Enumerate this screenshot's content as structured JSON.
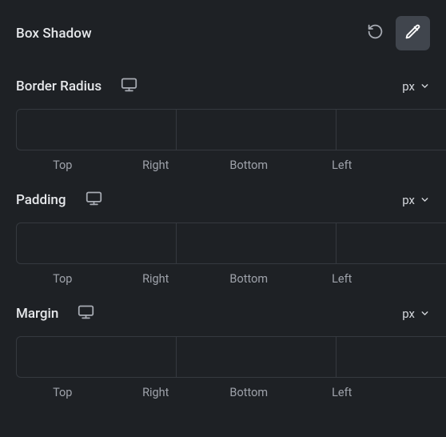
{
  "boxShadow": {
    "title": "Box Shadow"
  },
  "borderRadius": {
    "title": "Border Radius",
    "unit": "px",
    "sides": {
      "top": "Top",
      "right": "Right",
      "bottom": "Bottom",
      "left": "Left"
    },
    "values": {
      "top": "",
      "right": "",
      "bottom": "",
      "left": ""
    }
  },
  "padding": {
    "title": "Padding",
    "unit": "px",
    "sides": {
      "top": "Top",
      "right": "Right",
      "bottom": "Bottom",
      "left": "Left"
    },
    "values": {
      "top": "",
      "right": "",
      "bottom": "",
      "left": ""
    }
  },
  "margin": {
    "title": "Margin",
    "unit": "px",
    "sides": {
      "top": "Top",
      "right": "Right",
      "bottom": "Bottom",
      "left": "Left"
    },
    "values": {
      "top": "",
      "right": "",
      "bottom": "",
      "left": ""
    }
  }
}
